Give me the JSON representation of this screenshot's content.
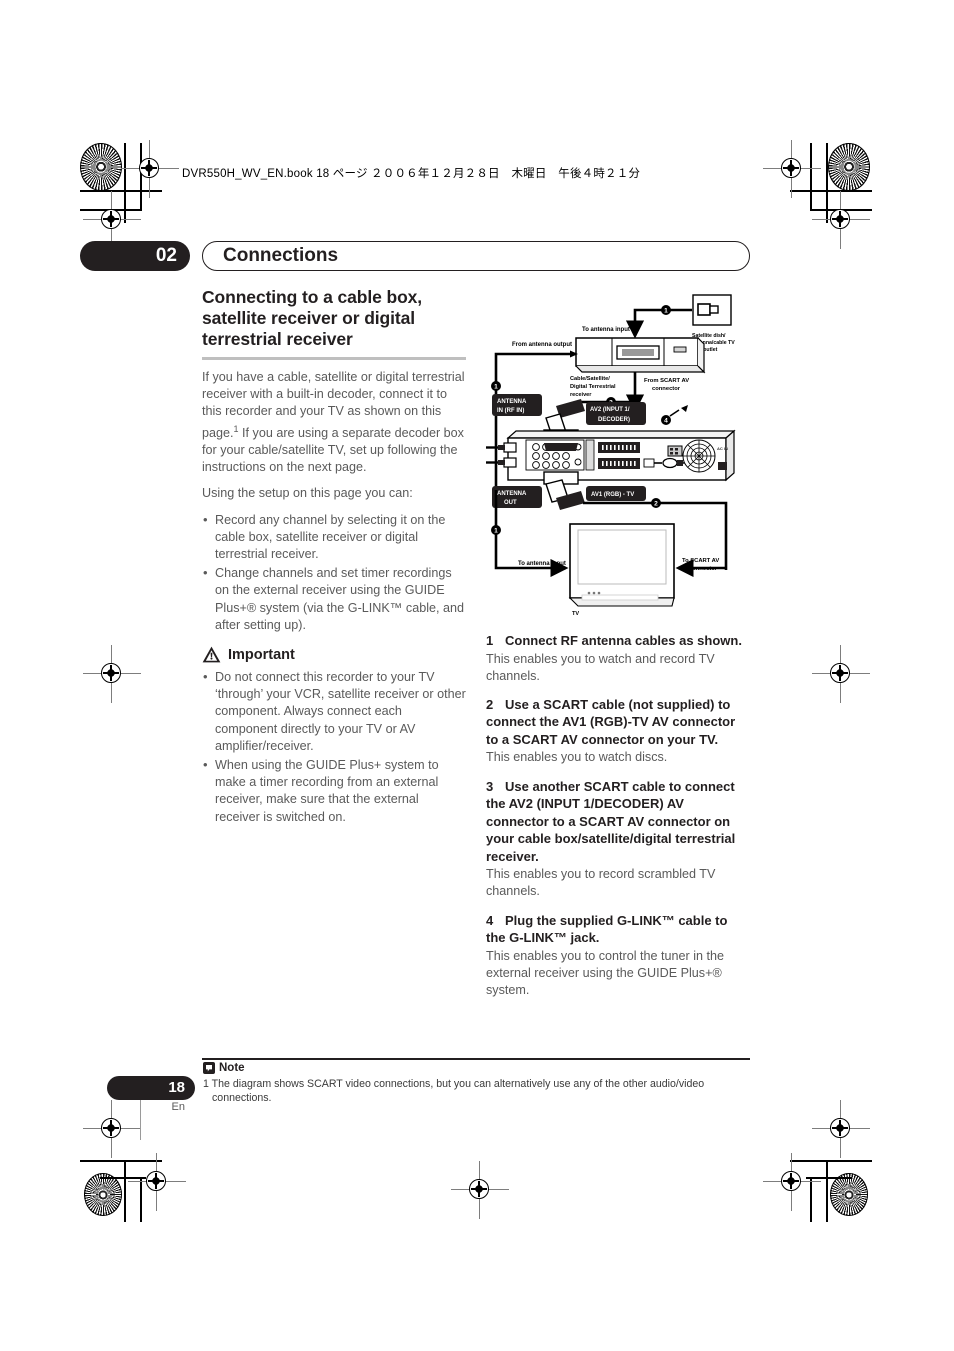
{
  "print_header": {
    "text": "DVR550H_WV_EN.book 18 ページ ２００６年１２月２８日　木曜日　午後４時２１分"
  },
  "chapter": {
    "number": "02",
    "title": "Connections"
  },
  "left_column": {
    "section_title": "Connecting to a cable box, satellite receiver or digital terrestrial receiver",
    "intro_paragraph_1": "If you have a cable, satellite or digital terrestrial receiver with a built-in decoder, connect it to this recorder and your TV as shown on this page.",
    "intro_footnote_marker": "1",
    "intro_paragraph_1b": " If you are using a separate decoder box for your cable/satellite TV, set up following the instructions on the next page.",
    "intro_paragraph_2": "Using the setup on this page you can:",
    "capability_bullets": [
      "Record any channel by selecting it on the cable box, satellite receiver or digital terrestrial receiver.",
      "Change channels and set timer recordings on the external receiver using the GUIDE Plus+® system (via the G-LINK™ cable, and after setting up)."
    ],
    "important_label": "Important",
    "important_bullets": [
      "Do not connect this recorder to your TV ‘through’ your VCR, satellite receiver or other component. Always connect each component directly to your TV or AV amplifier/receiver.",
      "When using the GUIDE Plus+ system to make a timer recording from an external receiver, make sure that the external receiver is switched on."
    ]
  },
  "right_column": {
    "steps": [
      {
        "number": "1",
        "heading": "Connect RF antenna cables as shown.",
        "description": "This enables you to watch and record TV channels."
      },
      {
        "number": "2",
        "heading": "Use a SCART cable (not supplied) to connect the AV1 (RGB)-TV AV connector to a SCART AV connector on your TV.",
        "description": "This enables you to watch discs."
      },
      {
        "number": "3",
        "heading": "Use another SCART cable to connect the AV2 (INPUT 1/DECODER) AV connector to a SCART AV connector on your cable box/satellite/digital terrestrial receiver.",
        "description": "This enables you to record scrambled TV channels."
      },
      {
        "number": "4",
        "heading": "Plug the supplied G-LINK™ cable to the G-LINK™ jack.",
        "description": "This enables you to control the tuner in the external receiver using the GUIDE Plus+® system."
      }
    ]
  },
  "diagram": {
    "labels": {
      "satellite_outlet": "Satellite dish/ antenna/cable TV wall outlet",
      "to_antenna_input_top": "To antenna input",
      "from_antenna_output": "From antenna output",
      "receiver_caption": "Cable/Satellite/ Digital Terrestrial receiver",
      "from_scart_av_connector": "From SCART AV connector",
      "antenna_in": "ANTENNA IN (RF IN)",
      "antenna_out": "ANTENNA OUT",
      "av2_connector": "AV2 (INPUT 1/ DECODER)",
      "av1_connector": "AV1 (RGB) - TV",
      "to_antenna_input_tv": "To antenna input",
      "to_scart_av_connector_tv": "To SCART AV connector",
      "tv_caption": "TV"
    },
    "callouts": [
      "1",
      "2",
      "3",
      "4"
    ]
  },
  "footer": {
    "page_number": "18",
    "language": "En",
    "note_label": "Note",
    "note_number": "1",
    "note_text": "The diagram shows SCART video connections, but you can alternatively use any of the other audio/video",
    "note_text_cont": "connections."
  }
}
